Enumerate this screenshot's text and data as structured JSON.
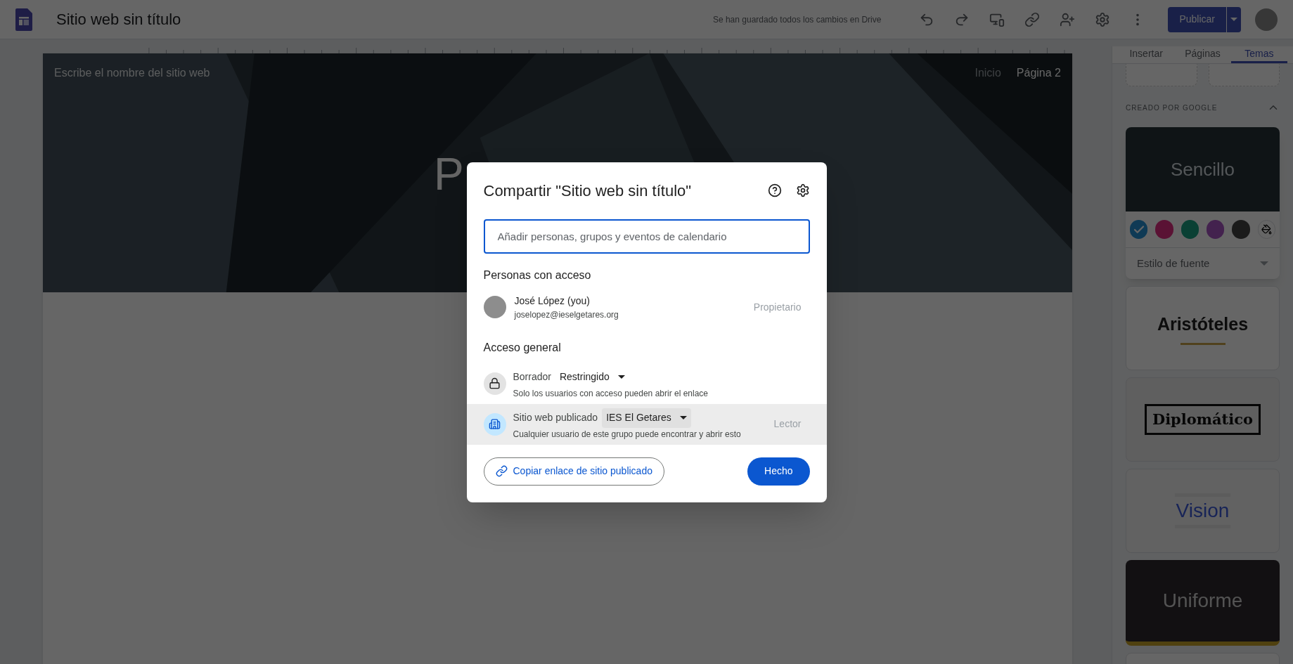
{
  "app_bar": {
    "title": "Sitio web sin título",
    "save_status": "Se han guardado todos los cambios en Drive",
    "publish_button": "Publicar"
  },
  "site": {
    "name_placeholder": "Escribe el nombre del sitio web",
    "nav": [
      {
        "label": "Inicio",
        "selected": false
      },
      {
        "label": "Página 2",
        "selected": true
      }
    ],
    "hero_title": "P"
  },
  "side_panel": {
    "tabs": [
      {
        "label": "Insertar",
        "selected": false
      },
      {
        "label": "Páginas",
        "selected": false
      },
      {
        "label": "Temas",
        "selected": true
      }
    ],
    "section_heading": "CREADO POR GOOGLE",
    "section_expanded": true,
    "themes": [
      {
        "kind": "sencillo",
        "name": "Sencillo",
        "swatches": [
          {
            "color": "#0f3a55",
            "selected": true
          },
          {
            "color": "#5a1234",
            "selected": false
          },
          {
            "color": "#0a4034",
            "selected": false
          },
          {
            "color": "#43224e",
            "selected": false
          },
          {
            "color": "#1b1b1b",
            "selected": false
          }
        ],
        "font_style": "Estilo de fuente"
      },
      {
        "kind": "aristoteles",
        "name": "Aristóteles"
      },
      {
        "kind": "diplomatico",
        "name": "Diplomático"
      },
      {
        "kind": "vision",
        "name": "Vision"
      },
      {
        "kind": "uniforme",
        "name": "Uniforme"
      }
    ]
  },
  "dialog": {
    "title": "Compartir \"Sitio web sin título\"",
    "search": {
      "placeholder": "Añadir personas, grupos y eventos de calendario"
    },
    "people_heading": "Personas con acceso",
    "people": [
      {
        "name": "José López (you)",
        "email": "joselopez@ieselgetares.org",
        "role": "Propietario"
      }
    ],
    "general_heading": "Acceso general",
    "access": [
      {
        "kind": "restricted",
        "label": "Borrador",
        "value": "Restringido",
        "description": "Solo los usuarios con acceso pueden abrir el enlace",
        "highlighted": false
      },
      {
        "kind": "group",
        "label": "Sitio web publicado",
        "value": "IES El Getares",
        "description": "Cualquier usuario de este grupo puede encontrar y abrir esto",
        "role": "Lector",
        "highlighted": true
      }
    ],
    "copy_link": "Copiar enlace de sitio publicado",
    "done": "Hecho"
  }
}
